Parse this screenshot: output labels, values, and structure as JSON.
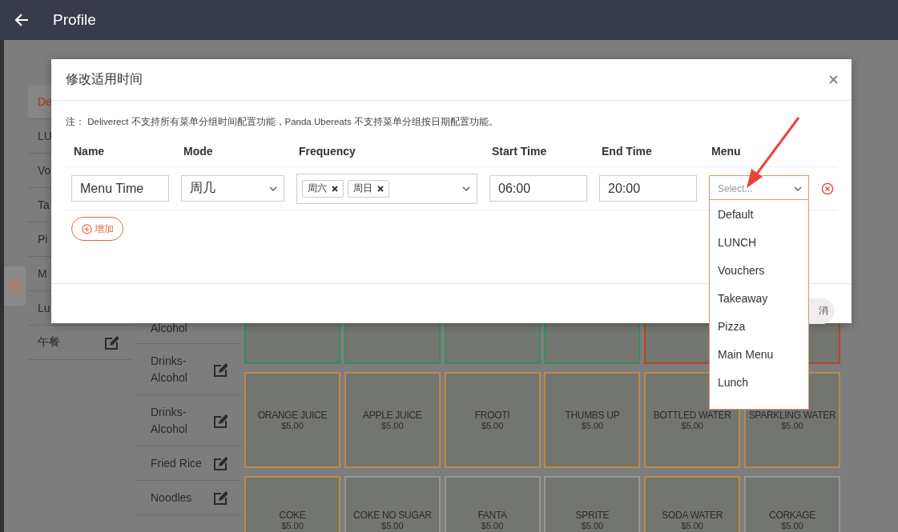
{
  "app_bar": {
    "title": "Profile"
  },
  "categories": [
    {
      "label": "De",
      "selected": true,
      "edit_icon": false
    },
    {
      "label": "LU",
      "selected": false,
      "edit_icon": false
    },
    {
      "label": "Vo",
      "selected": false,
      "edit_icon": false
    },
    {
      "label": "Ta",
      "selected": false,
      "edit_icon": false
    },
    {
      "label": "Pi",
      "selected": false,
      "edit_icon": false
    },
    {
      "label": "M",
      "selected": false,
      "edit_icon": false
    },
    {
      "label": "Lu",
      "selected": false,
      "edit_icon": false
    },
    {
      "label": "午餐",
      "selected": false,
      "edit_icon": true
    }
  ],
  "subcategories": [
    {
      "label": "Alcohol",
      "edit_icon": false
    },
    {
      "label": "Drinks-Alcohol",
      "edit_icon": true
    },
    {
      "label": "Drinks-Alcohol",
      "edit_icon": true
    },
    {
      "label": "Fried Rice",
      "edit_icon": true
    },
    {
      "label": "Noodles",
      "edit_icon": true
    }
  ],
  "products": [
    {
      "color": "#3d8a5a"
    },
    {
      "color": "#3d8a5a"
    },
    {
      "color": "#3d8a5a"
    },
    {
      "color": "#3d8a5a"
    },
    {
      "color": "#b5442a"
    },
    {
      "color": "#b5442a"
    },
    {
      "name": "ORANGE JUICE",
      "price": "$5.00",
      "color": "#b78a4a"
    },
    {
      "name": "APPLE JUICE",
      "price": "$5.00",
      "color": "#b78a4a"
    },
    {
      "name": "FROOTI",
      "price": "$5.00",
      "color": "#b78a4a"
    },
    {
      "name": "THUMBS UP",
      "price": "$5.00",
      "color": "#b78a4a"
    },
    {
      "name": "BOTTLED WATER",
      "price": "$5.00",
      "color": "#b78a4a"
    },
    {
      "name": "SPARKLING WATER",
      "price": "$5.00",
      "color": "#b78a4a"
    },
    {
      "name": "COKE",
      "price": "$5.00",
      "color": "#b78a4a"
    },
    {
      "name": "COKE NO SUGAR",
      "price": "$5.00",
      "color": "#959595"
    },
    {
      "name": "FANTA",
      "price": "$5.00",
      "color": "#959595"
    },
    {
      "name": "SPRITE",
      "price": "$5.00",
      "color": "#959595"
    },
    {
      "name": "SODA WATER",
      "price": "$5.00",
      "color": "#b78a4a"
    },
    {
      "name": "CORKAGE",
      "price": "$5.00",
      "color": "#959595"
    }
  ],
  "modal": {
    "title": "修改适用时间",
    "note": "注： Deliverect 不支持所有菜单分组时间配置功能，Panda Ubereats 不支持菜单分组按日期配置功能。",
    "columns": [
      "Name",
      "Mode",
      "Frequency",
      "Start Time",
      "End Time",
      "Menu"
    ],
    "rows": [
      {
        "name": "Menu Time",
        "mode": "周几",
        "frequency": [
          "周六",
          "周日"
        ],
        "start_time": "06:00",
        "end_time": "20:00",
        "menu": {
          "placeholder": "Select...",
          "open": true,
          "options": [
            {
              "label": "Default",
              "selected": false
            },
            {
              "label": "LUNCH",
              "selected": false
            },
            {
              "label": "Vouchers",
              "selected": false
            },
            {
              "label": "Takeaway",
              "selected": false
            },
            {
              "label": "Pizza",
              "selected": false
            },
            {
              "label": "Main Menu",
              "selected": false
            },
            {
              "label": "Lunch",
              "selected": false
            }
          ]
        }
      }
    ],
    "add_button": "增加",
    "cancel_button": "消"
  }
}
